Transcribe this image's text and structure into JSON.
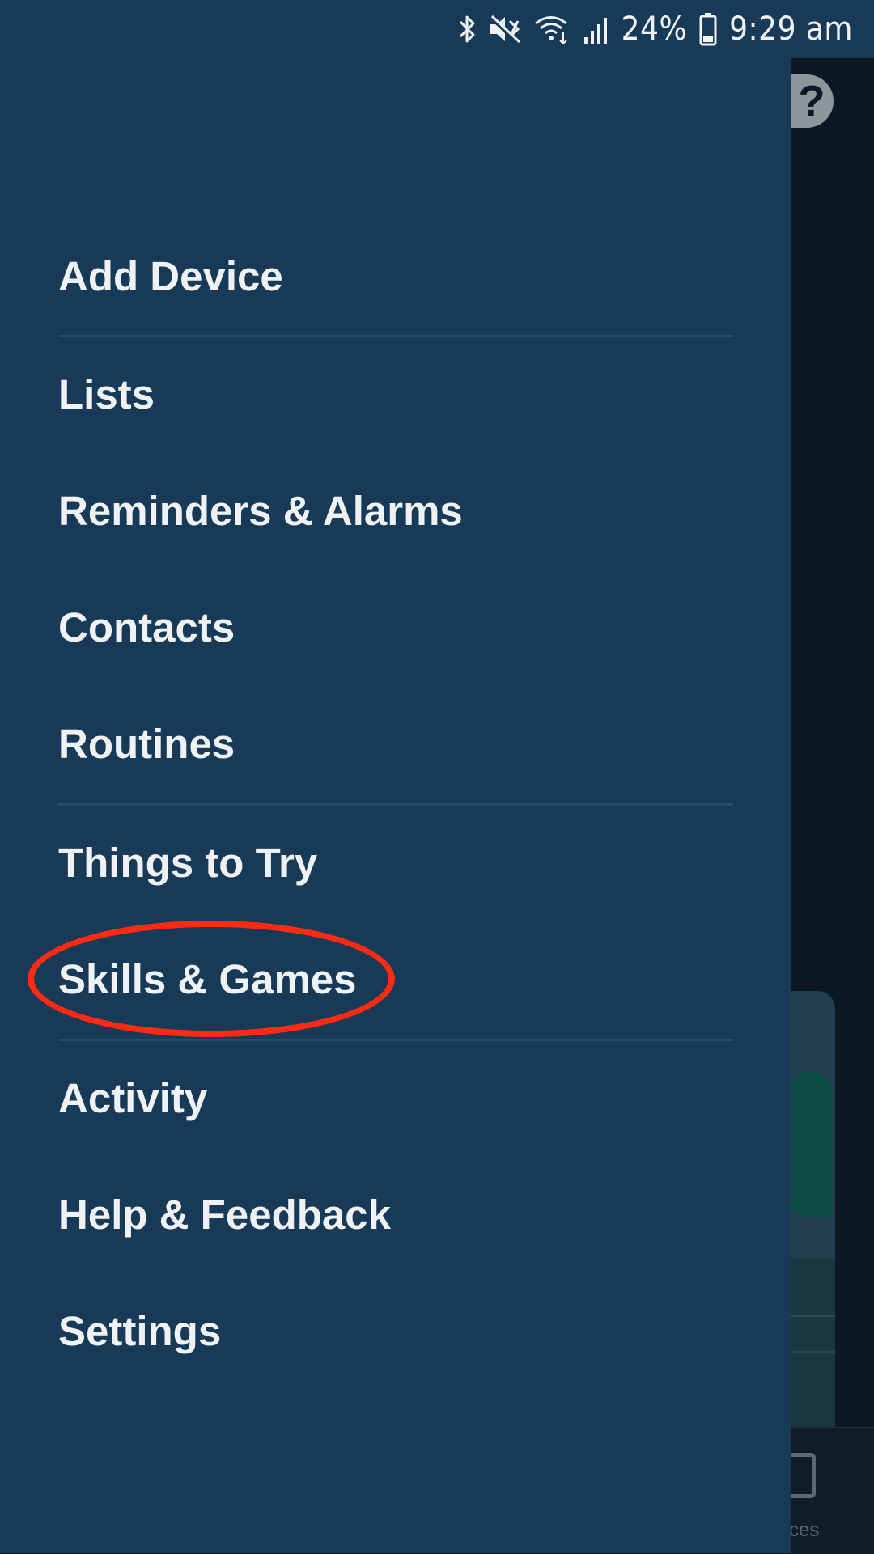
{
  "status_bar": {
    "battery_percent": "24%",
    "time": "9:29 am",
    "icons": [
      "bluetooth-icon",
      "mute-icon",
      "wifi-icon",
      "signal-icon",
      "battery-icon"
    ]
  },
  "menu": {
    "items": [
      {
        "label": "Add Device"
      },
      {
        "label": "Lists"
      },
      {
        "label": "Reminders & Alarms"
      },
      {
        "label": "Contacts"
      },
      {
        "label": "Routines"
      },
      {
        "label": "Things to Try"
      },
      {
        "label": "Skills & Games",
        "highlighted": true
      },
      {
        "label": "Activity"
      },
      {
        "label": "Help & Feedback"
      },
      {
        "label": "Settings"
      }
    ]
  },
  "background_app": {
    "help_icon_glyph": "?",
    "nav_label_partial": "ces"
  },
  "colors": {
    "drawer_background": "#183a56",
    "highlight_ring": "#ff2a14",
    "text": "#eef2f5"
  }
}
